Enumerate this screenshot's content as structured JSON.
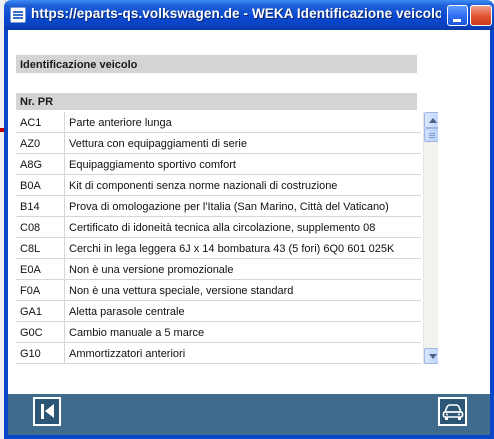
{
  "window": {
    "title": "https://eparts-qs.volkswagen.de - WEKA Identificazione veicolo ..."
  },
  "section": {
    "title": "Identificazione veicolo"
  },
  "table": {
    "column_header": "Nr. PR",
    "rows": [
      {
        "code": "AC1",
        "description": "Parte anteriore lunga"
      },
      {
        "code": "AZ0",
        "description": "Vettura con equipaggiamenti di serie"
      },
      {
        "code": "A8G",
        "description": "Equipaggiamento sportivo comfort"
      },
      {
        "code": "B0A",
        "description": "Kit di componenti senza norme nazionali di costruzione"
      },
      {
        "code": "B14",
        "description": "Prova di omologazione per l'Italia (San Marino, Città del Vaticano)"
      },
      {
        "code": "C08",
        "description": "Certificato di idoneità tecnica alla circolazione, supplemento 08"
      },
      {
        "code": "C8L",
        "description": "Cerchi in lega leggera 6J x 14 bombatura 43 (5 fori) 6Q0 601 025K"
      },
      {
        "code": "E0A",
        "description": "Non è una versione promozionale"
      },
      {
        "code": "F0A",
        "description": "Non è una vettura speciale, versione standard"
      },
      {
        "code": "GA1",
        "description": "Aletta parasole centrale"
      },
      {
        "code": "G0C",
        "description": "Cambio manuale a 5 marce"
      },
      {
        "code": "G10",
        "description": "Ammortizzatori anteriori"
      }
    ]
  },
  "colors": {
    "titlebar": "#0a4ad1",
    "header_bg": "#d4d4d4",
    "toolbar_bg": "#3f6c8c",
    "toolbar_button": "#2b5676"
  },
  "icons": {
    "first_page": "skip-to-first-icon",
    "vehicle": "car-icon"
  }
}
